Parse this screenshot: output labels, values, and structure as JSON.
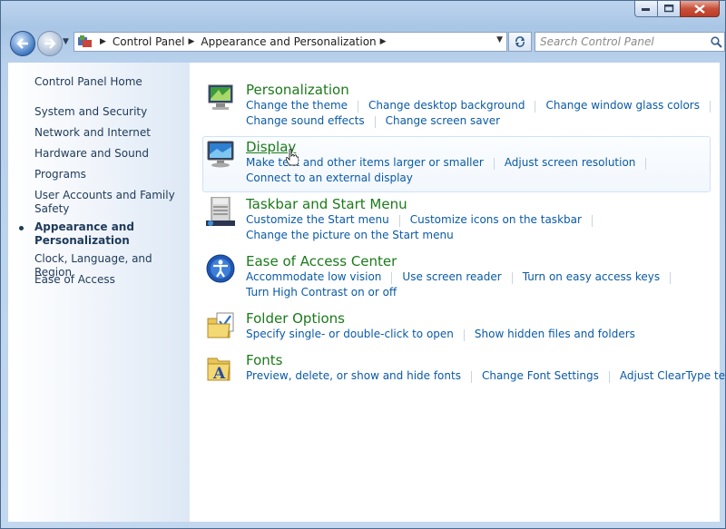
{
  "address": {
    "crumbs": [
      "Control Panel",
      "Appearance and Personalization"
    ]
  },
  "search": {
    "placeholder": "Search Control Panel"
  },
  "sidebar": {
    "items": [
      {
        "label": "Control Panel Home"
      },
      {
        "label": "System and Security"
      },
      {
        "label": "Network and Internet"
      },
      {
        "label": "Hardware and Sound"
      },
      {
        "label": "Programs"
      },
      {
        "label": "User Accounts and Family"
      },
      {
        "label": "Safety"
      },
      {
        "label": "Appearance and"
      },
      {
        "label": "Personalization"
      },
      {
        "label": "Clock, Language, and Region"
      },
      {
        "label": "Ease of Access"
      }
    ]
  },
  "categories": {
    "personalization": {
      "title": "Personalization",
      "links": [
        "Change the theme",
        "Change desktop background",
        "Change window glass colors",
        "Change sound effects",
        "Change screen saver"
      ]
    },
    "display": {
      "title": "Display",
      "links": [
        "Make text and other items larger or smaller",
        "Adjust screen resolution",
        "Connect to an external display"
      ]
    },
    "taskbar": {
      "title": "Taskbar and Start Menu",
      "links": [
        "Customize the Start menu",
        "Customize icons on the taskbar",
        "Change the picture on the Start menu"
      ]
    },
    "ease": {
      "title": "Ease of Access Center",
      "links": [
        "Accommodate low vision",
        "Use screen reader",
        "Turn on easy access keys",
        "Turn High Contrast on or off"
      ]
    },
    "folder": {
      "title": "Folder Options",
      "links": [
        "Specify single- or double-click to open",
        "Show hidden files and folders"
      ]
    },
    "fonts": {
      "title": "Fonts",
      "links": [
        "Preview, delete, or show and hide fonts",
        "Change Font Settings",
        "Adjust ClearType text"
      ]
    }
  },
  "colors": {
    "title_green": "#1b7a1b",
    "link_blue": "#0a5aa6",
    "nav_text": "#1e3a5a"
  }
}
